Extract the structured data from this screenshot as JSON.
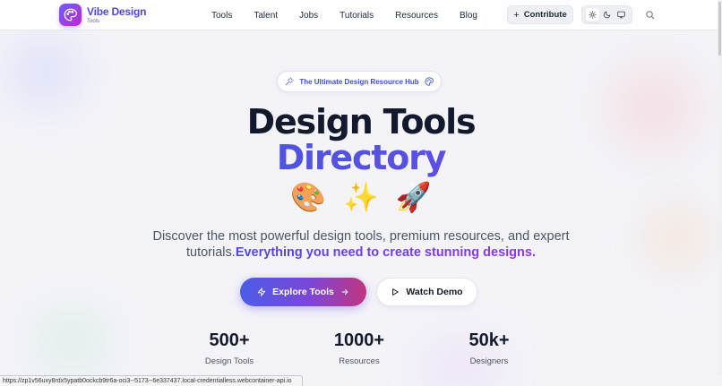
{
  "header": {
    "brand_name": "Vibe Design",
    "brand_sub": "Tools",
    "nav": [
      {
        "label": "Tools",
        "icon": ""
      },
      {
        "label": "Talent",
        "icon": ""
      },
      {
        "label": "Jobs",
        "icon": ""
      },
      {
        "label": "Tutorials",
        "icon": ""
      },
      {
        "label": "Resources",
        "icon": ""
      },
      {
        "label": "Blog",
        "icon": ""
      }
    ],
    "contribute_label": "Contribute",
    "theme_modes": [
      "sun-icon",
      "moon-icon",
      "monitor-icon"
    ],
    "active_theme": "light"
  },
  "hero": {
    "pill_text": "The Ultimate Design Resource Hub",
    "title_line1": "Design Tools",
    "title_line2": "Directory",
    "emojis": [
      "🎨",
      "✨",
      "🚀"
    ],
    "description_plain": "Discover the most powerful design tools, premium resources, and expert tutorials.",
    "description_highlight": "Everything you need to create stunning designs.",
    "primary_cta": "Explore Tools",
    "secondary_cta": "Watch Demo"
  },
  "stats": [
    {
      "value": "500+",
      "label": "Design Tools"
    },
    {
      "value": "1000+",
      "label": "Resources"
    },
    {
      "value": "50k+",
      "label": "Designers"
    }
  ],
  "status_url": "https://zp1v56uxy8rdx5ypatb0ockcb9tr6a-oci3--5173--6e337437.local-credentialless.webcontainer-api.io",
  "colors": {
    "brand": "#4f46e5",
    "accent_gradient_start": "#3b5bdb",
    "accent_gradient_end": "#7048e8",
    "cta_gradient_end": "#c2357f"
  }
}
